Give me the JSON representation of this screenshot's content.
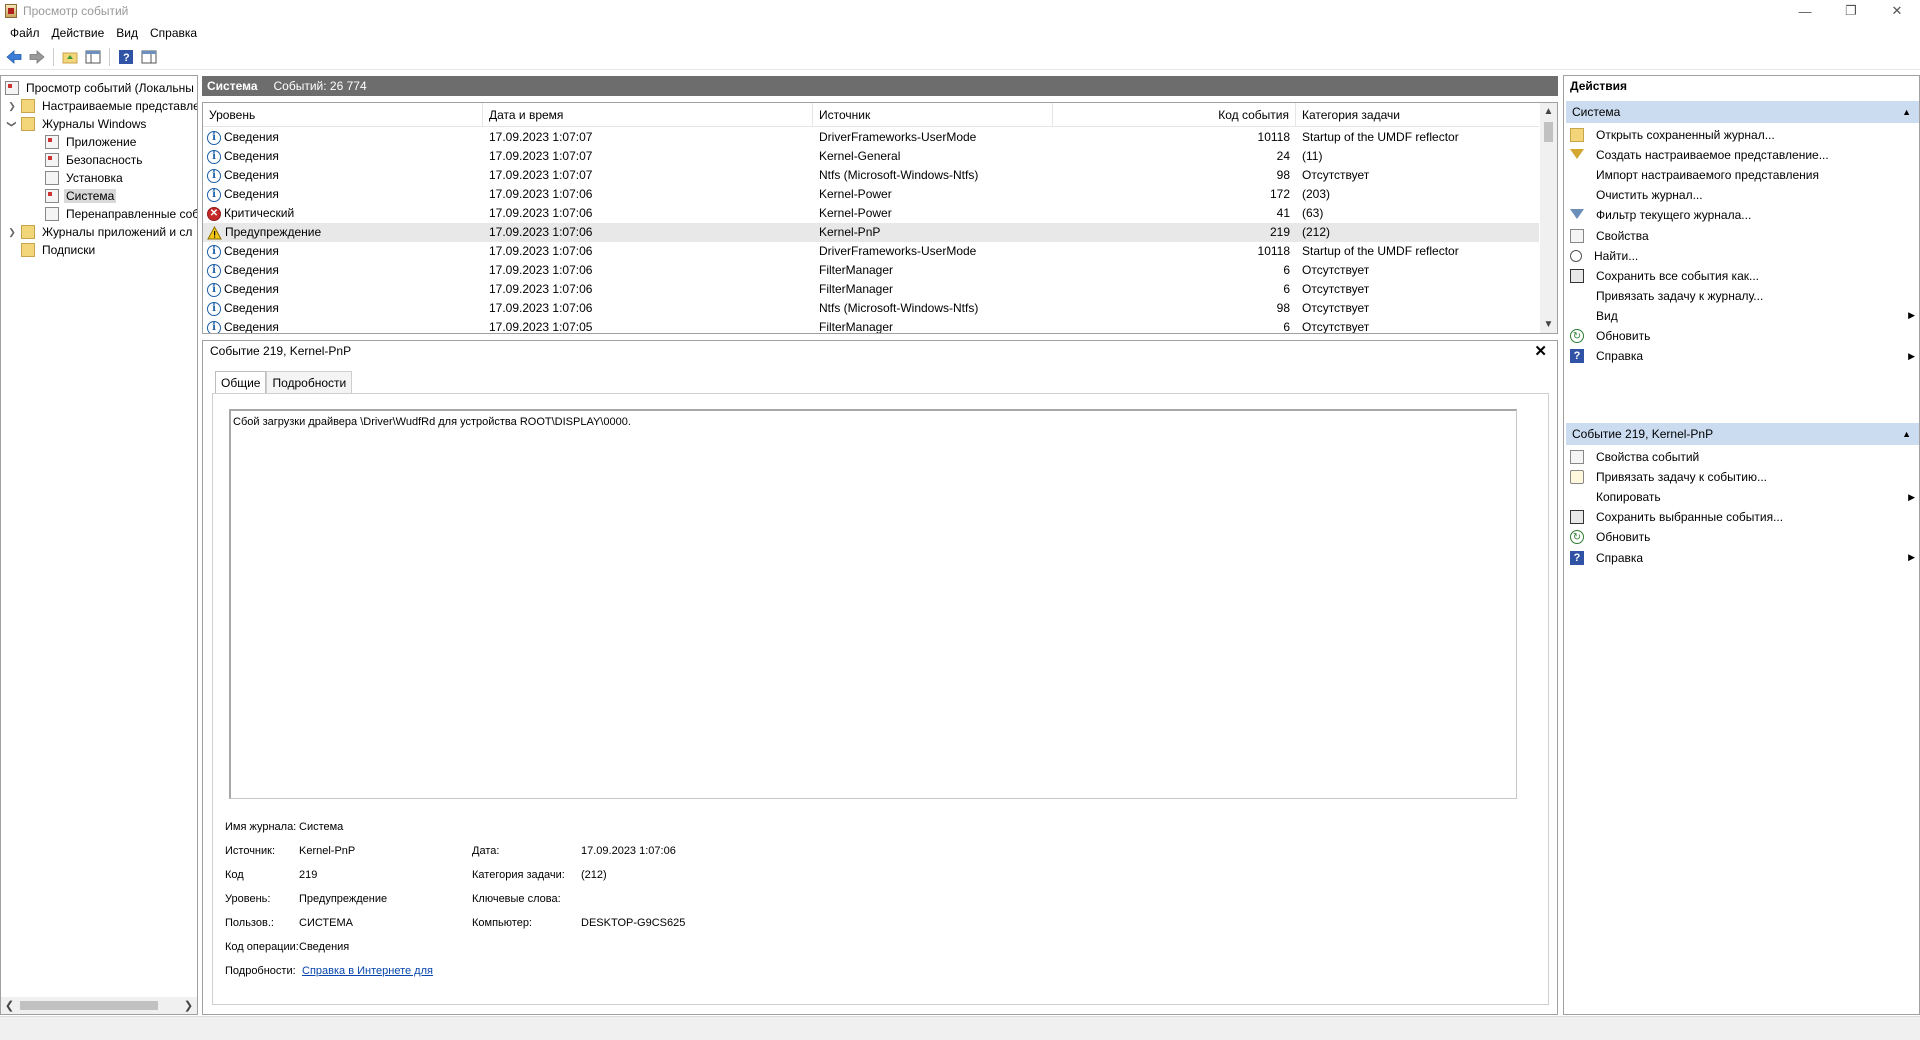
{
  "window": {
    "title": "Просмотр событий"
  },
  "menu": [
    "Файл",
    "Действие",
    "Вид",
    "Справка"
  ],
  "toolbar": [
    "back-icon",
    "forward-icon",
    "folder-up-icon",
    "show-pane-icon",
    "help-icon",
    "properties-icon"
  ],
  "tree": {
    "root": "Просмотр событий (Локальны",
    "custom_views": "Настраиваемые представле",
    "windows_logs": "Журналы Windows",
    "application": "Приложение",
    "security": "Безопасность",
    "setup": "Установка",
    "system": "Система",
    "forwarded": "Перенаправленные соб",
    "app_logs": "Журналы приложений и сл",
    "subscriptions": "Подписки"
  },
  "header": {
    "name": "Система",
    "count": "Событий: 26 774"
  },
  "events_table": {
    "columns": [
      "Уровень",
      "Дата и время",
      "Источник",
      "Код события",
      "Категория задачи"
    ],
    "rows": [
      {
        "level": "Сведения",
        "kind": "info",
        "datetime": "17.09.2023 1:07:07",
        "source": "DriverFrameworks-UserMode",
        "code": "10118",
        "category": "Startup of the UMDF reflector"
      },
      {
        "level": "Сведения",
        "kind": "info",
        "datetime": "17.09.2023 1:07:07",
        "source": "Kernel-General",
        "code": "24",
        "category": "(11)"
      },
      {
        "level": "Сведения",
        "kind": "info",
        "datetime": "17.09.2023 1:07:07",
        "source": "Ntfs (Microsoft-Windows-Ntfs)",
        "code": "98",
        "category": "Отсутствует"
      },
      {
        "level": "Сведения",
        "kind": "info",
        "datetime": "17.09.2023 1:07:06",
        "source": "Kernel-Power",
        "code": "172",
        "category": "(203)"
      },
      {
        "level": "Критический",
        "kind": "crit",
        "datetime": "17.09.2023 1:07:06",
        "source": "Kernel-Power",
        "code": "41",
        "category": "(63)"
      },
      {
        "level": "Предупреждение",
        "kind": "warn",
        "datetime": "17.09.2023 1:07:06",
        "source": "Kernel-PnP",
        "code": "219",
        "category": "(212)"
      },
      {
        "level": "Сведения",
        "kind": "info",
        "datetime": "17.09.2023 1:07:06",
        "source": "DriverFrameworks-UserMode",
        "code": "10118",
        "category": "Startup of the UMDF reflector"
      },
      {
        "level": "Сведения",
        "kind": "info",
        "datetime": "17.09.2023 1:07:06",
        "source": "FilterManager",
        "code": "6",
        "category": "Отсутствует"
      },
      {
        "level": "Сведения",
        "kind": "info",
        "datetime": "17.09.2023 1:07:06",
        "source": "FilterManager",
        "code": "6",
        "category": "Отсутствует"
      },
      {
        "level": "Сведения",
        "kind": "info",
        "datetime": "17.09.2023 1:07:06",
        "source": "Ntfs (Microsoft-Windows-Ntfs)",
        "code": "98",
        "category": "Отсутствует"
      },
      {
        "level": "Сведения",
        "kind": "info",
        "datetime": "17.09.2023 1:07:05",
        "source": "FilterManager",
        "code": "6",
        "category": "Отсутствует"
      }
    ]
  },
  "details": {
    "title": "Событие 219, Kernel-PnP",
    "tabs": [
      "Общие",
      "Подробности"
    ],
    "description": "Сбой загрузки драйвера \\Driver\\WudfRd для устройства ROOT\\DISPLAY\\0000.",
    "labels": {
      "log_name": "Имя журнала:",
      "source": "Источник:",
      "code": "Код",
      "level": "Уровень:",
      "user": "Пользов.:",
      "opcode": "Код операции:",
      "more": "Подробности:",
      "date": "Дата:",
      "task": "Категория задачи:",
      "keywords": "Ключевые слова:",
      "computer": "Компьютер:"
    },
    "values": {
      "log_name": "Система",
      "source": "Kernel-PnP",
      "code": "219",
      "level": "Предупреждение",
      "user": "СИСТЕМА",
      "opcode": "Сведения",
      "more": "Справка в Интернете для ",
      "date": "17.09.2023 1:07:06",
      "task": "(212)",
      "keywords": "",
      "computer": "DESKTOP-G9CS625"
    }
  },
  "actions": {
    "title": "Действия",
    "section1": "Система",
    "items1": [
      {
        "label": "Открыть сохраненный журнал...",
        "icon": "open-log-icon"
      },
      {
        "label": "Создать настраиваемое представление...",
        "icon": "filter-create-icon"
      },
      {
        "label": "Импорт настраиваемого представления",
        "icon": ""
      },
      {
        "label": "Очистить журнал...",
        "icon": ""
      },
      {
        "label": "Фильтр текущего журнала...",
        "icon": "filter-icon"
      },
      {
        "label": "Свойства",
        "icon": "properties-icon"
      },
      {
        "label": "Найти...",
        "icon": "find-icon"
      },
      {
        "label": "Сохранить все события как...",
        "icon": "save-icon"
      },
      {
        "label": "Привязать задачу к журналу...",
        "icon": ""
      },
      {
        "label": "Вид",
        "icon": ""
      },
      {
        "label": "Обновить",
        "icon": "refresh-icon"
      },
      {
        "label": "Справка",
        "icon": "help-icon"
      }
    ],
    "section2": "Событие 219, Kernel-PnP",
    "items2": [
      {
        "label": "Свойства событий",
        "icon": "event-properties-icon"
      },
      {
        "label": "Привязать задачу к событию...",
        "icon": "attach-task-icon"
      },
      {
        "label": "Копировать",
        "icon": "copy-icon"
      },
      {
        "label": "Сохранить выбранные события...",
        "icon": "save-icon"
      },
      {
        "label": "Обновить",
        "icon": "refresh-icon"
      },
      {
        "label": "Справка",
        "icon": "help-icon"
      }
    ]
  }
}
